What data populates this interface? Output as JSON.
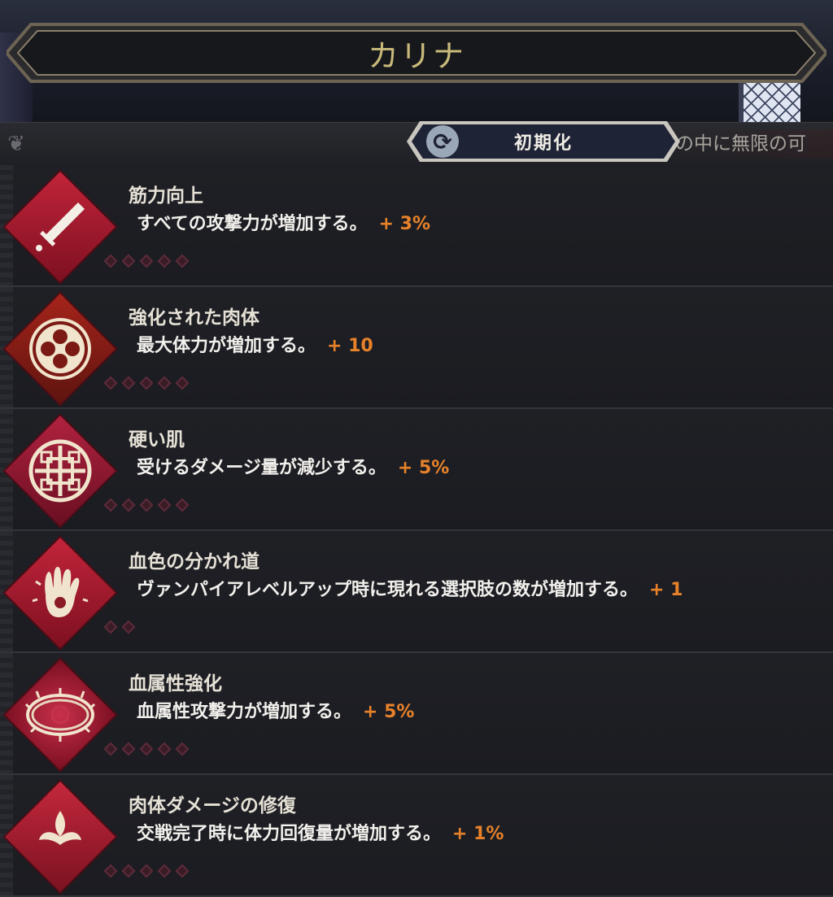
{
  "header": {
    "title": "カリナ"
  },
  "toolbar": {
    "reset_label": "初期化",
    "reset_icon": "refresh-icon",
    "marquee_text": "の中に無限の可"
  },
  "colors": {
    "accent": "#e8822a",
    "skill_red": "#c2243a",
    "title_gold": "#c9ba7a"
  },
  "skills": [
    {
      "name": "筋力向上",
      "desc": "すべての攻撃力が増加する。",
      "bonus": "+ 3%",
      "icon": "sword-icon",
      "pips": 5
    },
    {
      "name": "強化された肉体",
      "desc": "最大体力が増加する。",
      "bonus": "+ 10",
      "icon": "quatrefoil-icon",
      "pips": 5
    },
    {
      "name": "硬い肌",
      "desc": "受けるダメージ量が減少する。",
      "bonus": "+ 5%",
      "icon": "shield-knot-icon",
      "pips": 5
    },
    {
      "name": "血色の分かれ道",
      "desc": "ヴァンパイアレベルアップ時に現れる選択肢の数が増加する。",
      "bonus": "+ 1",
      "icon": "bloody-hand-icon",
      "pips": 2
    },
    {
      "name": "血属性強化",
      "desc": "血属性攻撃力が増加する。",
      "bonus": "+ 5%",
      "icon": "thorn-crown-icon",
      "pips": 5
    },
    {
      "name": "肉体ダメージの修復",
      "desc": "交戦完了時に体力回復量が増加する。",
      "bonus": "+ 1%",
      "icon": "fleur-icon",
      "pips": 5
    }
  ]
}
